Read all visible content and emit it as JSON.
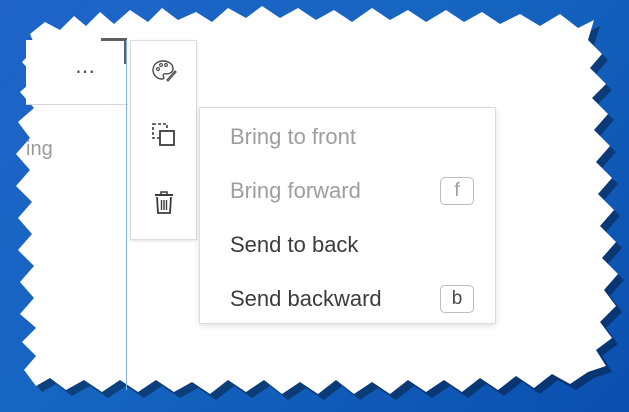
{
  "toolbar_header": {
    "more_glyph": "⋯",
    "partial_text": "ing"
  },
  "toolbar": {
    "tools": [
      {
        "name": "paint-palette",
        "icon": "palette-icon"
      },
      {
        "name": "arrange",
        "icon": "arrange-icon"
      },
      {
        "name": "delete",
        "icon": "trash-icon"
      }
    ]
  },
  "arrange_menu": {
    "items": [
      {
        "label": "Bring to front",
        "enabled": false,
        "shortcut": ""
      },
      {
        "label": "Bring forward",
        "enabled": false,
        "shortcut": "f"
      },
      {
        "label": "Send to back",
        "enabled": true,
        "shortcut": ""
      },
      {
        "label": "Send backward",
        "enabled": true,
        "shortcut": "b"
      }
    ]
  },
  "colors": {
    "background_blue": "#1565c0",
    "accent_line": "#7fb6e6",
    "disabled_text": "#9e9e9e",
    "enabled_text": "#3c3c3c"
  }
}
